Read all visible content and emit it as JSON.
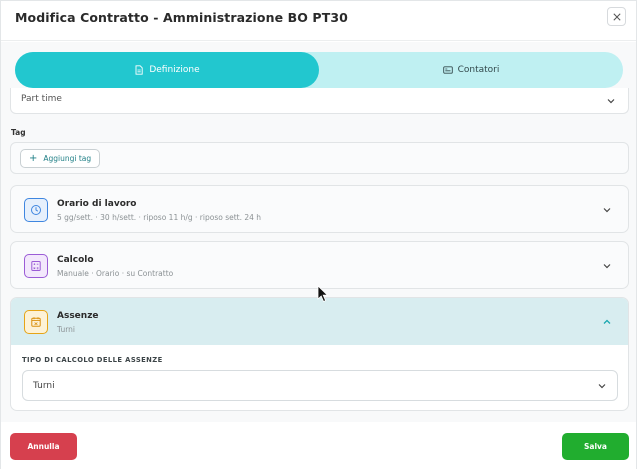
{
  "modal": {
    "title": "Modifica Contratto - Amministrazione BO PT30"
  },
  "tabs": [
    {
      "label": "Definizione",
      "icon": "document-icon",
      "active": true
    },
    {
      "label": "Contatori",
      "icon": "card-icon",
      "active": false
    }
  ],
  "contract_type": {
    "value": "Part time"
  },
  "tag": {
    "label": "Tag",
    "add_label": "Aggiungi tag"
  },
  "sections": {
    "orario": {
      "title": "Orario di lavoro",
      "subtitle": "5 gg/sett. · 30 h/sett. · riposo 11 h/g · riposo sett. 24 h",
      "icon": "clock-icon",
      "color": "#3f86e0"
    },
    "calcolo": {
      "title": "Calcolo",
      "subtitle": "Manuale · Orario · su Contratto",
      "icon": "calculator-icon",
      "color": "#9b5cd6"
    },
    "assenze": {
      "title": "Assenze",
      "subtitle": "Turni",
      "icon": "calendar-icon",
      "color": "#e6a416",
      "expanded": true,
      "field_label": "TIPO DI CALCOLO DELLE ASSENZE",
      "field_value": "Turni"
    }
  },
  "footer": {
    "cancel_label": "Annulla",
    "save_label": "Salva"
  },
  "colors": {
    "accent": "#22c7cf",
    "cancel": "#d6404e",
    "save": "#21ad2f"
  }
}
